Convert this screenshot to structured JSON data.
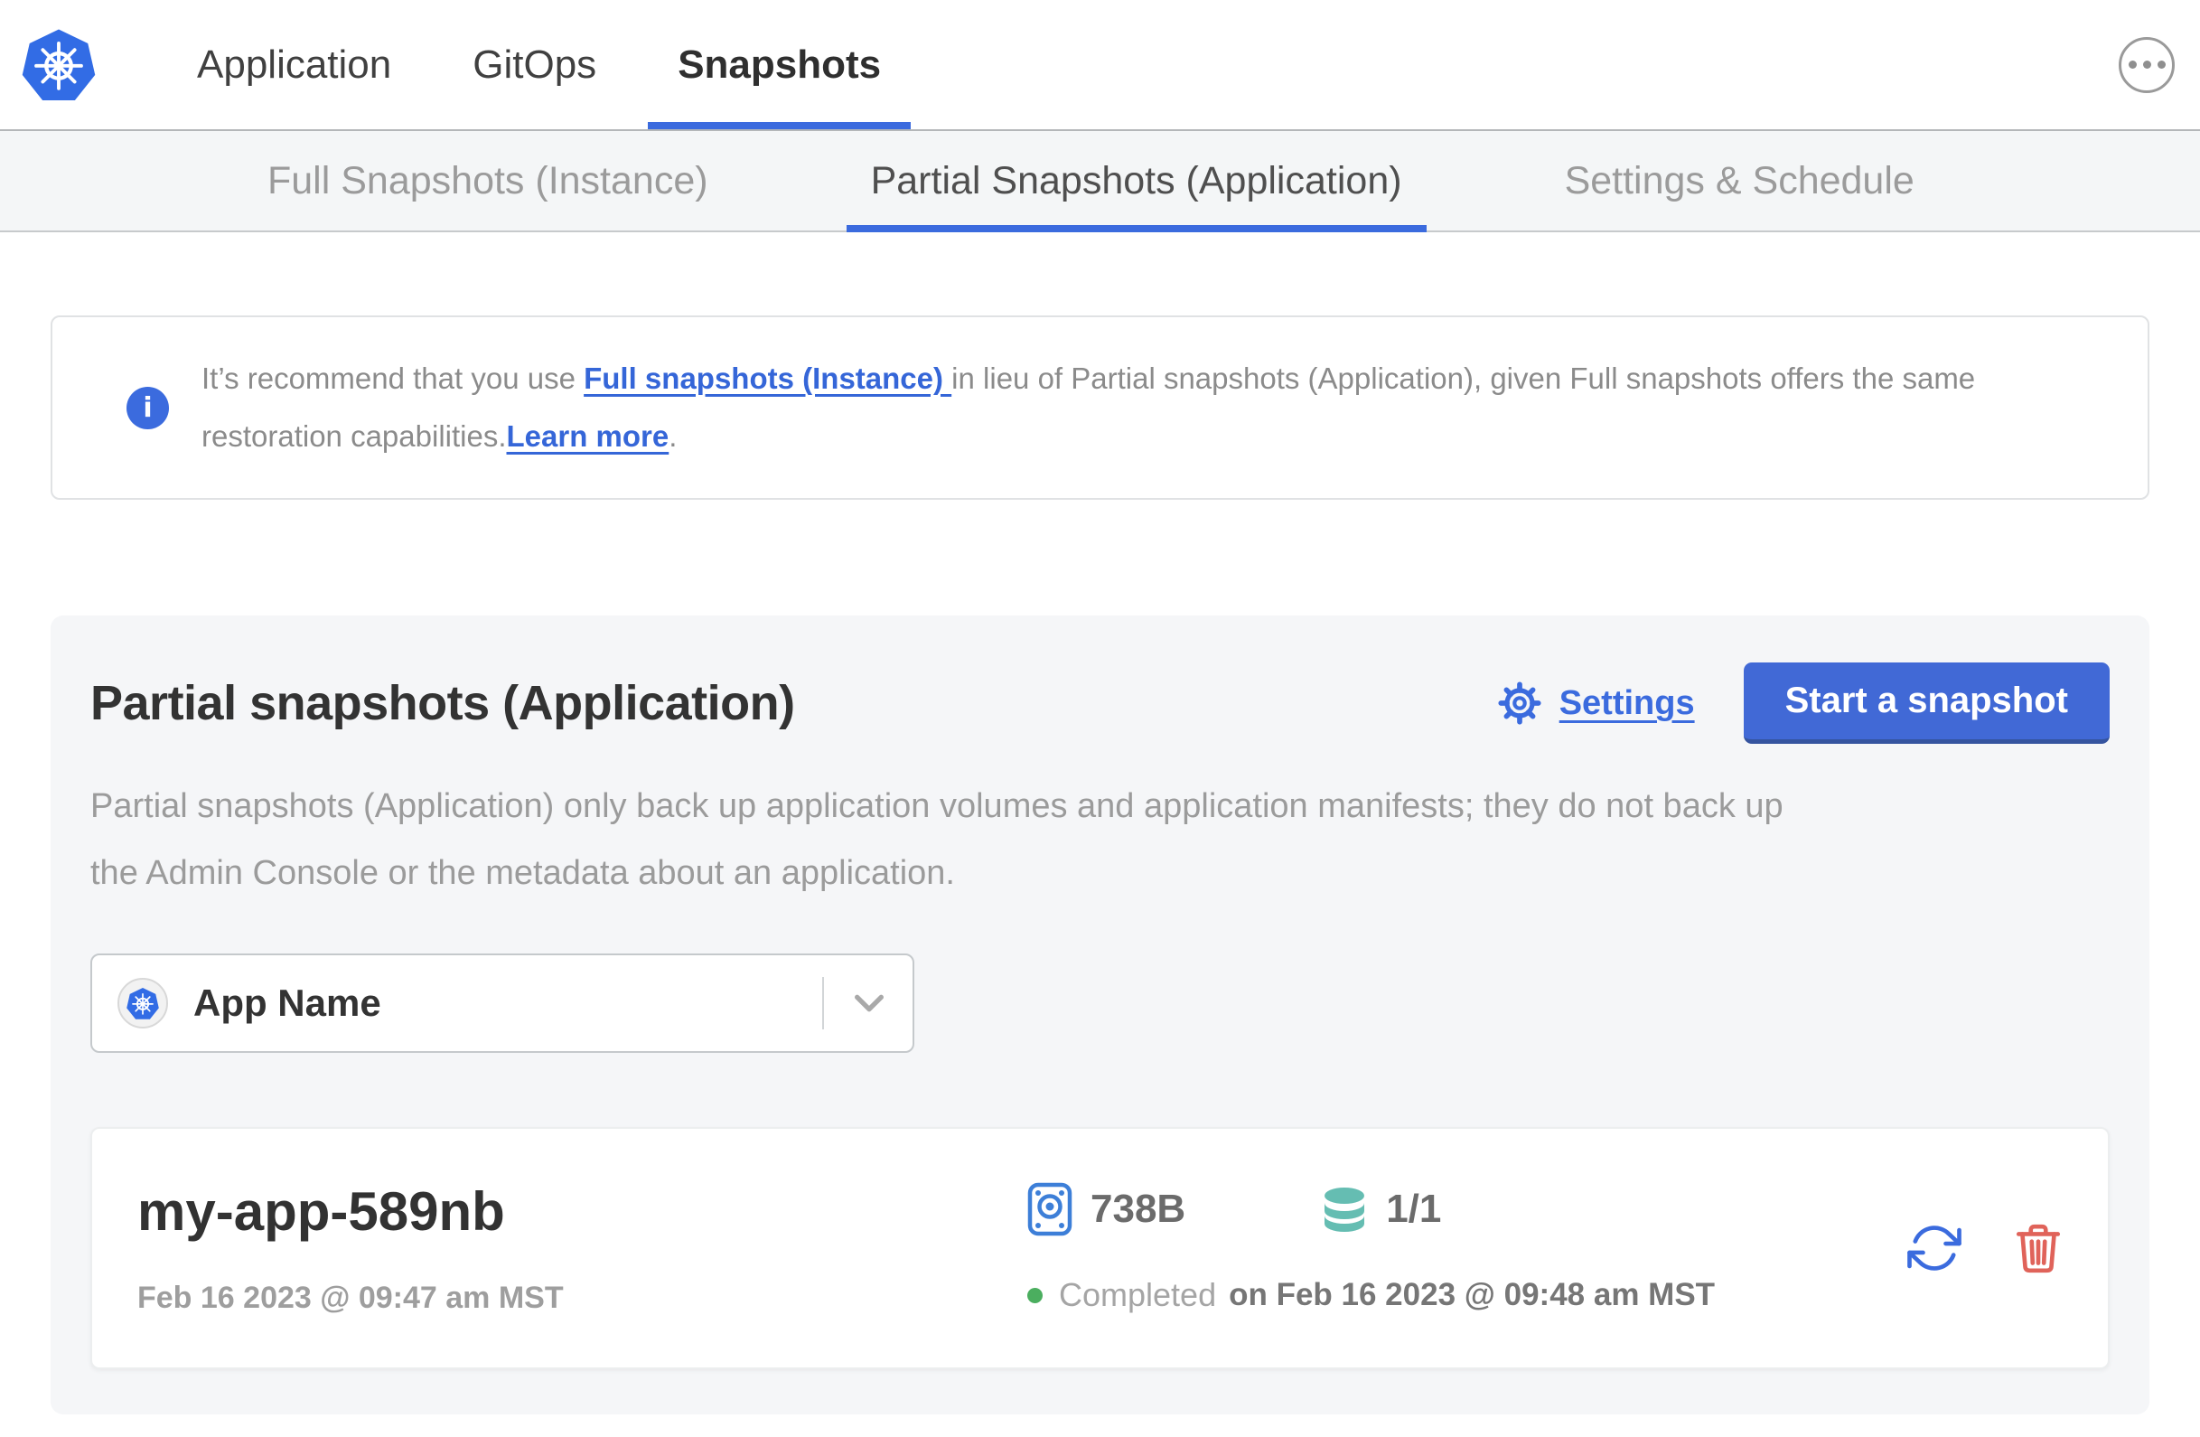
{
  "colors": {
    "accent_blue": "#3b6bde",
    "button_blue": "#4169d6",
    "button_blue_shadow": "#35549f",
    "kubernetes_blue": "#326ce5",
    "disk_icon_blue": "#3d7fd8",
    "volume_teal": "#65bdb2",
    "danger_red": "#e0635a",
    "success_green": "#4bae5f"
  },
  "header": {
    "nav": [
      {
        "label": "Application"
      },
      {
        "label": "GitOps"
      },
      {
        "label": "Snapshots"
      }
    ]
  },
  "subnav": {
    "tabs": [
      {
        "label": "Full Snapshots (Instance)"
      },
      {
        "label": "Partial Snapshots (Application)"
      },
      {
        "label": "Settings & Schedule"
      }
    ]
  },
  "banner": {
    "info_glyph": "i",
    "text_before": "It’s recommend that you use ",
    "link_full_snapshots": "Full snapshots (Instance) ",
    "text_middle": "in lieu of Partial snapshots (Application), given Full snapshots offers the same restoration capabilities.",
    "link_learn_more": "Learn more",
    "text_after": "."
  },
  "panel": {
    "title": "Partial snapshots (Application)",
    "settings_label": "Settings",
    "start_snapshot_label": "Start a snapshot",
    "description_line1": "Partial snapshots (Application) only back up application volumes and application manifests; they do not back up",
    "description_line2": "the Admin Console or the metadata about an application.",
    "app_selector": {
      "value": "App Name"
    }
  },
  "snapshot_row": {
    "name": "my-app-589nb",
    "started_at": "Feb 16 2023 @ 09:47 am MST",
    "size": "738B",
    "volume_count": "1/1",
    "status": "Completed",
    "finished_at": "on Feb 16 2023 @ 09:48 am MST"
  }
}
